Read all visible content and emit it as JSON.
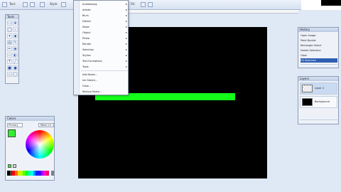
{
  "toolbar": {
    "labels": [
      "Tool:",
      "Style:",
      "Fill:"
    ]
  },
  "menu": {
    "items": [
      {
        "label": "Antialiasing",
        "arrow": true
      },
      {
        "label": "Artistic",
        "arrow": true
      },
      {
        "label": "Blurs",
        "arrow": true
      },
      {
        "label": "Distort",
        "arrow": true
      },
      {
        "label": "Noise",
        "arrow": true
      },
      {
        "label": "Object",
        "arrow": true
      },
      {
        "label": "Photo",
        "arrow": true
      },
      {
        "label": "Render",
        "arrow": true
      },
      {
        "label": "Selection",
        "arrow": true
      },
      {
        "label": "Stylize",
        "arrow": true
      },
      {
        "label": "Text Formations",
        "arrow": true
      },
      {
        "label": "Tools",
        "arrow": true
      },
      {
        "label": "Add Noise...",
        "arrow": false
      },
      {
        "label": "Ink Sketch...",
        "arrow": false
      },
      {
        "label": "Glow...",
        "arrow": false
      },
      {
        "label": "Reduce Noise...",
        "arrow": false
      }
    ]
  },
  "tools": {
    "title": "Tools"
  },
  "colors": {
    "title": "Colors",
    "mode": "Primary",
    "more": "More >>"
  },
  "history": {
    "title": "History",
    "items": [
      "Open Image",
      "Paint Bucket",
      "Rectangle Select",
      "Delete Selection",
      "Glow",
      "Fill Selection"
    ]
  },
  "layers": {
    "title": "Layers",
    "items": [
      "Layer 2",
      "Background"
    ]
  },
  "colors_theme": {
    "canvas": "#000000",
    "bar": "#14ff1a",
    "primary": "#33ee33"
  }
}
